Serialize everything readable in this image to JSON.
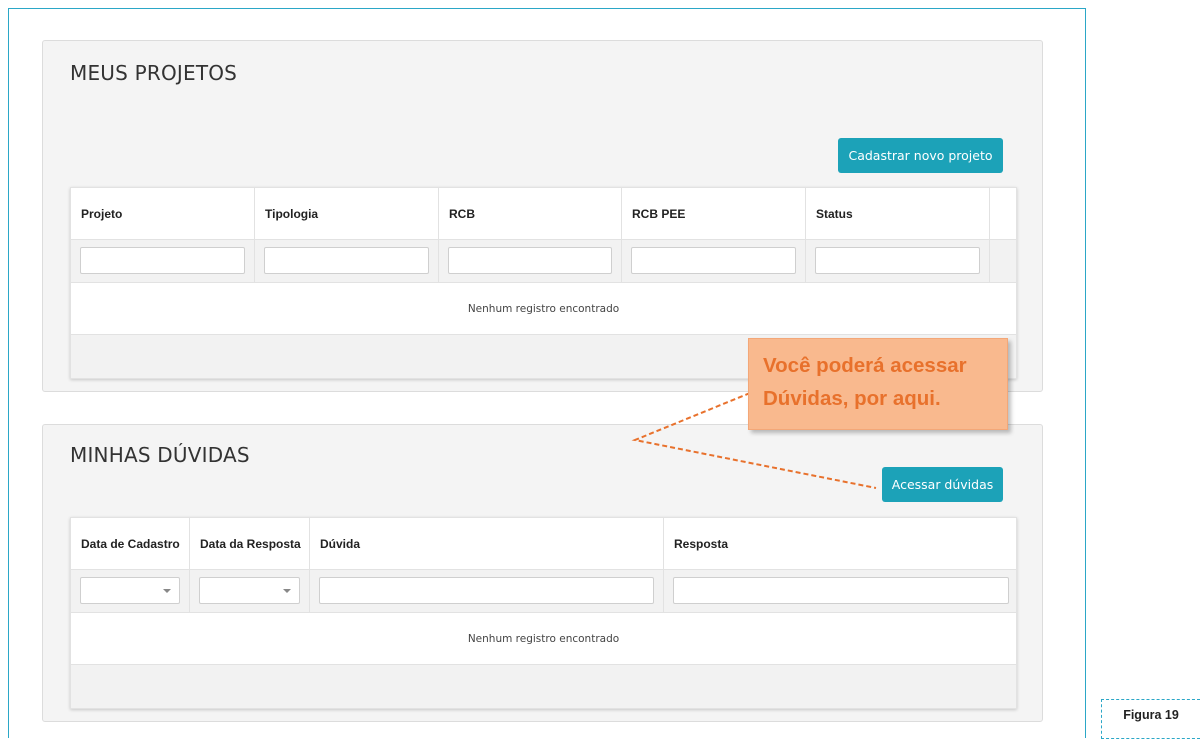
{
  "projects": {
    "title": "MEUS PROJETOS",
    "new_button": "Cadastrar novo projeto",
    "columns": [
      "Projeto",
      "Tipologia",
      "RCB",
      "RCB PEE",
      "Status"
    ],
    "empty_message": "Nenhum registro encontrado"
  },
  "questions": {
    "title": "MINHAS DÚVIDAS",
    "access_button": "Acessar dúvidas",
    "columns": [
      "Data de Cadastro",
      "Data da Resposta",
      "Dúvida",
      "Resposta"
    ],
    "empty_message": "Nenhum registro encontrado"
  },
  "callout": {
    "line1": "Você poderá acessar",
    "line2": "Dúvidas, por aqui."
  },
  "figure_label": "Figura 19",
  "colors": {
    "accent": "#1ca2b8",
    "frame": "#2ba7c7",
    "callout_bg": "#f9b98e",
    "callout_text": "#e8712c"
  }
}
